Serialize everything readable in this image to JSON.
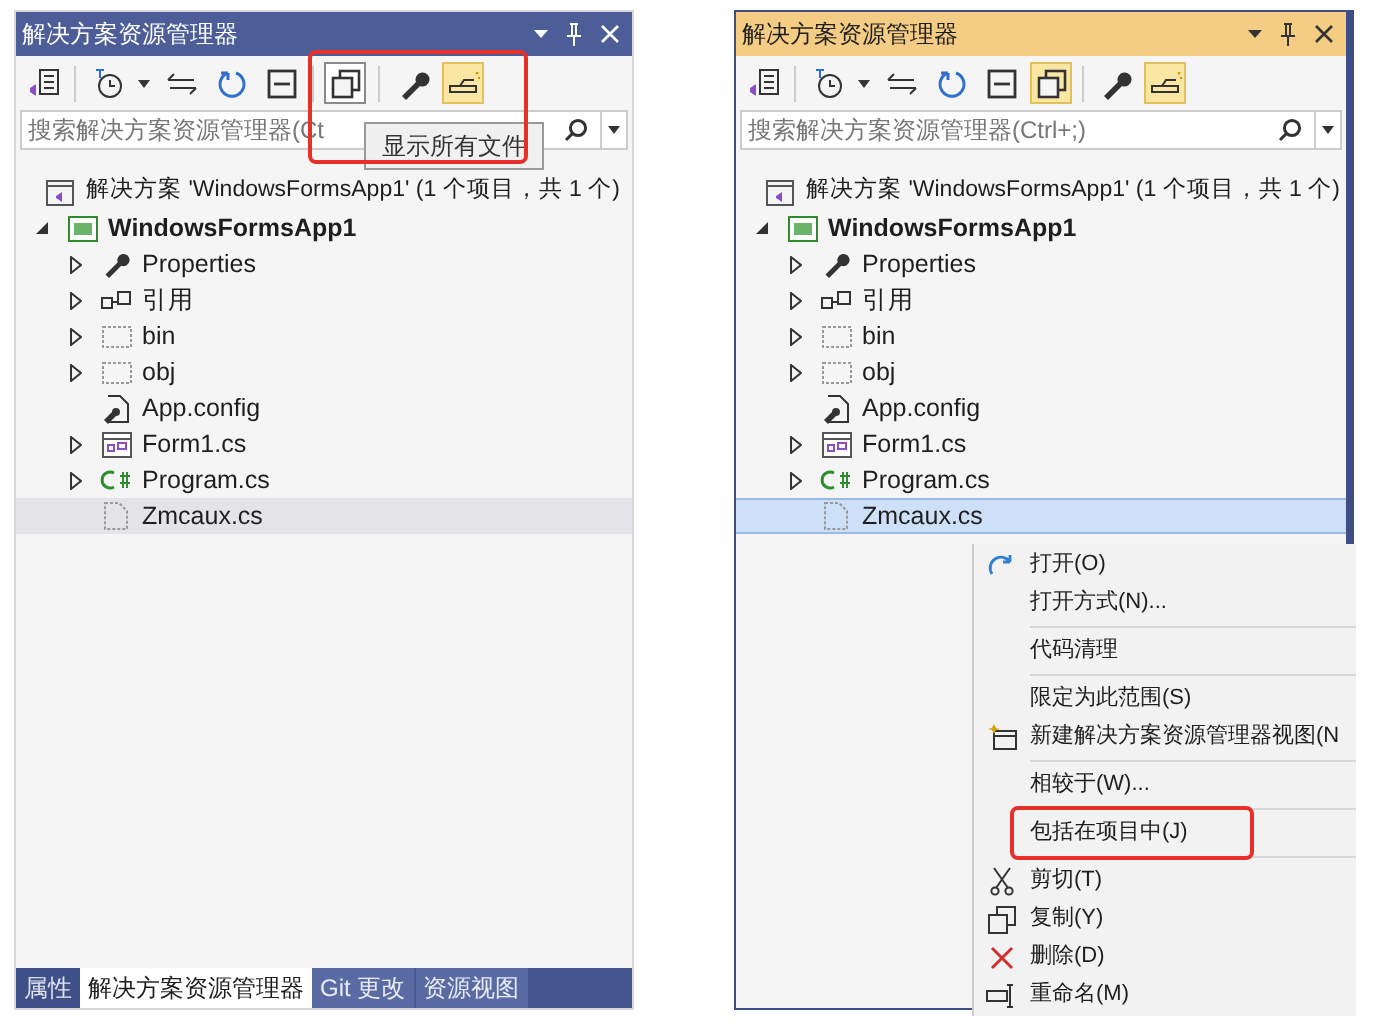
{
  "panels": [
    {
      "title": "解决方案资源管理器",
      "active": false,
      "toolbar": [
        {
          "buttons": [
            {
              "kind": "home",
              "pressed": false,
              "hovered": false
            }
          ]
        },
        {
          "buttons": [
            {
              "kind": "history",
              "pressed": false,
              "hovered": false
            },
            {
              "kind": "caret",
              "pressed": false,
              "hovered": false
            },
            {
              "kind": "sync",
              "pressed": false,
              "hovered": false
            },
            {
              "kind": "refresh",
              "pressed": false,
              "hovered": false
            },
            {
              "kind": "collapse",
              "pressed": false,
              "hovered": false
            }
          ]
        },
        {
          "annotated": true,
          "buttons": [
            {
              "kind": "show-all",
              "pressed": false,
              "hovered": true
            },
            {
              "kind": "separator"
            },
            {
              "kind": "properties",
              "pressed": false,
              "hovered": false
            },
            {
              "kind": "preview",
              "pressed": true,
              "hovered": false
            }
          ]
        }
      ],
      "search": {
        "placeholder": "搜索解决方案资源管理器(Ct"
      },
      "tooltip": "显示所有文件",
      "tree": [
        {
          "label": "解决方案 'WindowsFormsApp1' (1 个项目，共 1 个)",
          "kind": "solution",
          "selected": false,
          "children": [
            {
              "label": "WindowsFormsApp1",
              "kind": "project",
              "expanded": true,
              "selected": false,
              "children": [
                {
                  "label": "Properties",
                  "kind": "properties",
                  "expanded": false,
                  "selected": false
                },
                {
                  "label": "引用",
                  "kind": "references",
                  "expanded": false,
                  "selected": false
                },
                {
                  "label": "bin",
                  "kind": "folder",
                  "expanded": false,
                  "selected": false
                },
                {
                  "label": "obj",
                  "kind": "folder",
                  "expanded": false,
                  "selected": false
                },
                {
                  "label": "App.config",
                  "kind": "config",
                  "selected": false
                },
                {
                  "label": "Form1.cs",
                  "kind": "form",
                  "expanded": false,
                  "selected": false
                },
                {
                  "label": "Program.cs",
                  "kind": "csharp",
                  "expanded": false,
                  "selected": false
                },
                {
                  "label": "Zmcaux.cs",
                  "kind": "file",
                  "selected": true
                }
              ]
            }
          ]
        }
      ],
      "bottom_tabs": [
        {
          "label": "属性",
          "selected": false
        },
        {
          "label": "解决方案资源管理器",
          "selected": true
        },
        {
          "label": "Git 更改",
          "selected": false
        },
        {
          "label": "资源视图",
          "selected": false
        }
      ]
    },
    {
      "title": "解决方案资源管理器",
      "active": true,
      "toolbar": [
        {
          "buttons": [
            {
              "kind": "home",
              "pressed": false,
              "hovered": false
            }
          ]
        },
        {
          "buttons": [
            {
              "kind": "history",
              "pressed": false,
              "hovered": false
            },
            {
              "kind": "caret",
              "pressed": false,
              "hovered": false
            },
            {
              "kind": "sync",
              "pressed": false,
              "hovered": false
            },
            {
              "kind": "refresh",
              "pressed": false,
              "hovered": false
            },
            {
              "kind": "collapse",
              "pressed": false,
              "hovered": false
            },
            {
              "kind": "show-all",
              "pressed": true,
              "hovered": false
            }
          ]
        },
        {
          "buttons": [
            {
              "kind": "properties",
              "pressed": false,
              "hovered": false
            },
            {
              "kind": "preview",
              "pressed": true,
              "hovered": false
            }
          ]
        }
      ],
      "search": {
        "placeholder": "搜索解决方案资源管理器(Ctrl+;)"
      },
      "tree": [
        {
          "label": "解决方案 'WindowsFormsApp1' (1 个项目，共 1 个)",
          "kind": "solution",
          "selected": false,
          "children": [
            {
              "label": "WindowsFormsApp1",
              "kind": "project",
              "expanded": true,
              "selected": false,
              "children": [
                {
                  "label": "Properties",
                  "kind": "properties",
                  "expanded": false,
                  "selected": false
                },
                {
                  "label": "引用",
                  "kind": "references",
                  "expanded": false,
                  "selected": false
                },
                {
                  "label": "bin",
                  "kind": "folder",
                  "expanded": false,
                  "selected": false
                },
                {
                  "label": "obj",
                  "kind": "folder",
                  "expanded": false,
                  "selected": false
                },
                {
                  "label": "App.config",
                  "kind": "config",
                  "selected": false
                },
                {
                  "label": "Form1.cs",
                  "kind": "form",
                  "expanded": false,
                  "selected": false
                },
                {
                  "label": "Program.cs",
                  "kind": "csharp",
                  "expanded": false,
                  "selected": false
                },
                {
                  "label": "Zmcaux.cs",
                  "kind": "file",
                  "selected": true
                }
              ]
            }
          ]
        }
      ],
      "context_menu": [
        {
          "kind": "open",
          "label": "打开(O)"
        },
        {
          "kind": "plain",
          "label": "打开方式(N)..."
        },
        {
          "kind": "separator"
        },
        {
          "kind": "plain",
          "label": "代码清理"
        },
        {
          "kind": "separator"
        },
        {
          "kind": "plain",
          "label": "限定为此范围(S)"
        },
        {
          "kind": "new-view",
          "label": "新建解决方案资源管理器视图(N"
        },
        {
          "kind": "separator"
        },
        {
          "kind": "plain",
          "label": "相较于(W)..."
        },
        {
          "kind": "separator"
        },
        {
          "kind": "plain",
          "label": "包括在项目中(J)",
          "annotated": true
        },
        {
          "kind": "separator"
        },
        {
          "kind": "cut",
          "label": "剪切(T)"
        },
        {
          "kind": "copy",
          "label": "复制(Y)"
        },
        {
          "kind": "delete",
          "label": "删除(D)"
        },
        {
          "kind": "rename",
          "label": "重命名(M)"
        }
      ]
    }
  ]
}
